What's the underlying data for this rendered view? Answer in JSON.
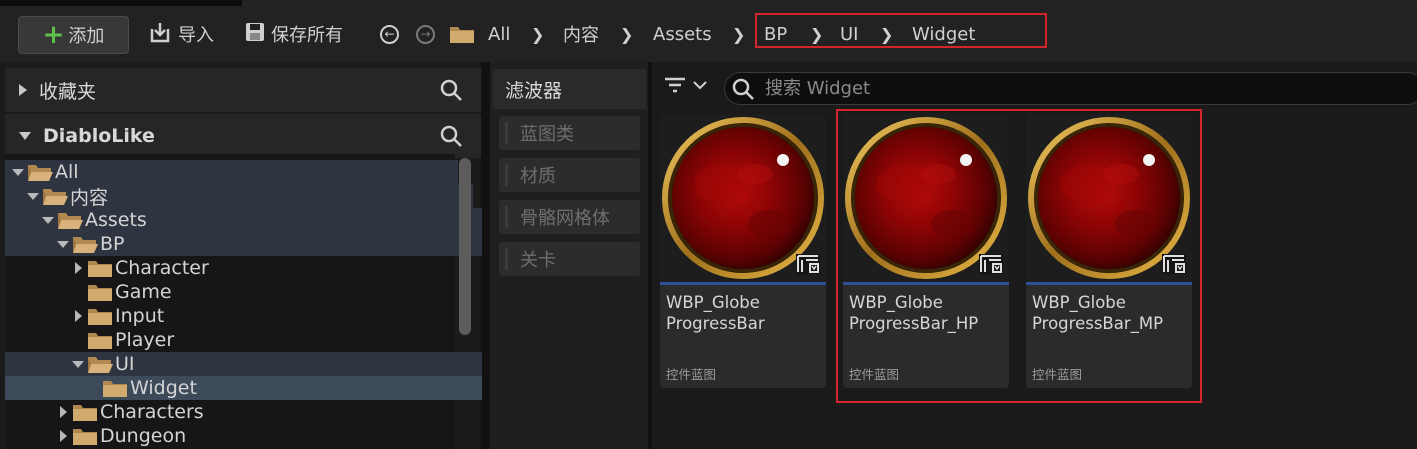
{
  "toolbar": {
    "add_label": "添加",
    "import_label": "导入",
    "save_all_label": "保存所有"
  },
  "breadcrumb": [
    "All",
    "内容",
    "Assets",
    "BP",
    "UI",
    "Widget"
  ],
  "left_panel": {
    "favorites_label": "收藏夹",
    "project_label": "DiabloLike",
    "tree": [
      {
        "label": "All",
        "depth": 0,
        "state": "open"
      },
      {
        "label": "内容",
        "depth": 1,
        "state": "open"
      },
      {
        "label": "Assets",
        "depth": 2,
        "state": "open"
      },
      {
        "label": "BP",
        "depth": 3,
        "state": "open"
      },
      {
        "label": "Character",
        "depth": 4,
        "state": "closed"
      },
      {
        "label": "Game",
        "depth": 4,
        "state": "none"
      },
      {
        "label": "Input",
        "depth": 4,
        "state": "closed"
      },
      {
        "label": "Player",
        "depth": 4,
        "state": "none"
      },
      {
        "label": "UI",
        "depth": 4,
        "state": "open"
      },
      {
        "label": "Widget",
        "depth": 5,
        "state": "none"
      },
      {
        "label": "Characters",
        "depth": 3,
        "state": "closed"
      },
      {
        "label": "Dungeon",
        "depth": 3,
        "state": "closed"
      }
    ]
  },
  "filter_panel": {
    "title": "滤波器",
    "items": [
      "蓝图类",
      "材质",
      "骨骼网格体",
      "关卡"
    ]
  },
  "assets_panel": {
    "search_placeholder": "搜索 Widget",
    "cards": [
      {
        "name_line1": "WBP_Globe",
        "name_line2": "ProgressBar",
        "type": "控件蓝图"
      },
      {
        "name_line1": "WBP_Globe",
        "name_line2": "ProgressBar_HP",
        "type": "控件蓝图"
      },
      {
        "name_line1": "WBP_Globe",
        "name_line2": "ProgressBar_MP",
        "type": "控件蓝图"
      }
    ]
  },
  "colors": {
    "highlight_box": "#d4252c",
    "add_plus": "#5fc24a",
    "folder": "#c9a26a",
    "card_stripe": "#2f4f9a",
    "selected_row": "#3d4a5a"
  }
}
